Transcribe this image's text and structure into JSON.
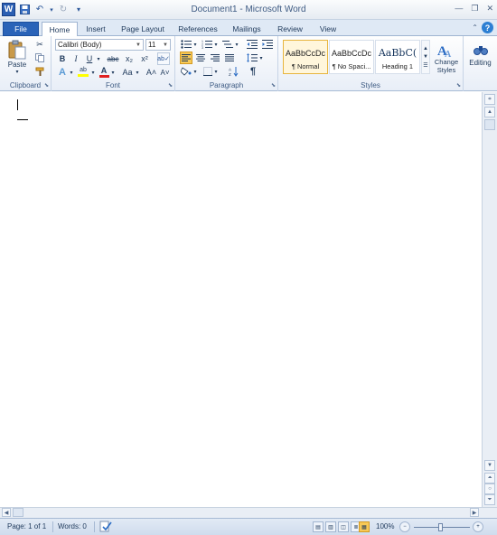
{
  "window": {
    "title": "Document1  -  Microsoft Word",
    "minimize": "—",
    "restore": "❐",
    "close": "✕"
  },
  "qat": {
    "app_icon": "W",
    "save_icon": "💾",
    "undo_icon": "↶",
    "redo_icon": "↻",
    "customize_icon": "▾"
  },
  "tabs": [
    "File",
    "Home",
    "Insert",
    "Page Layout",
    "References",
    "Mailings",
    "Review",
    "View"
  ],
  "ribbon": {
    "clipboard": {
      "label": "Clipboard",
      "paste": "Paste",
      "paste_arrow": "▾"
    },
    "font": {
      "label": "Font",
      "font_name": "Calibri (Body)",
      "font_size": "11",
      "grow": "A˄",
      "shrink": "A˅",
      "bold": "B",
      "italic": "I",
      "underline": "U",
      "strike": "abc",
      "subscript": "x₂",
      "superscript": "x²",
      "text_effects": "A",
      "highlight": "ab",
      "font_color": "A",
      "change_case": "Aa",
      "clear": "A"
    },
    "paragraph": {
      "label": "Paragraph",
      "pilcrow": "¶"
    },
    "styles": {
      "label": "Styles",
      "items": [
        {
          "preview": "AaBbCcDc",
          "name": "¶ Normal"
        },
        {
          "preview": "AaBbCcDc",
          "name": "¶ No Spaci..."
        },
        {
          "preview": "AaBbC(",
          "name": "Heading 1"
        }
      ],
      "change_styles": "Change Styles"
    },
    "editing": {
      "label": "Editing"
    }
  },
  "status": {
    "page": "Page: 1 of 1",
    "words": "Words: 0",
    "zoom": "100%"
  },
  "colors": {
    "accent": "#2a63b8",
    "highlight_yellow": "#ffff00",
    "font_red": "#e02020"
  }
}
